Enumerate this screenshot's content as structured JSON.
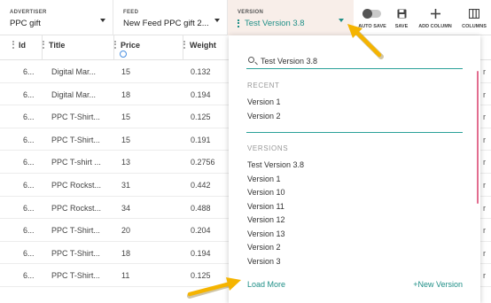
{
  "toolbar": {
    "advertiser": {
      "label": "ADVERTISER",
      "value": "PPC gift"
    },
    "feed": {
      "label": "FEED",
      "value": "New Feed PPC gift 2..."
    },
    "version": {
      "label": "VERSION",
      "value": "Test Version 3.8"
    },
    "actions": [
      {
        "label": "AUTO SAVE",
        "icon": "toggle-icon"
      },
      {
        "label": "SAVE",
        "icon": "save-icon"
      },
      {
        "label": "ADD COLUMN",
        "icon": "plus-icon"
      },
      {
        "label": "COLUMNS",
        "icon": "columns-icon"
      }
    ]
  },
  "table": {
    "headers": {
      "id": "Id",
      "title": "Title",
      "price": "Price",
      "weight": "Weight"
    },
    "rows": [
      {
        "id": "6...",
        "title": "Digital Mar...",
        "price": "15",
        "weight": "0.132",
        "extra": "r"
      },
      {
        "id": "6...",
        "title": "Digital Mar...",
        "price": "18",
        "weight": "0.194",
        "extra": "r"
      },
      {
        "id": "6...",
        "title": "PPC T-Shirt...",
        "price": "15",
        "weight": "0.125",
        "extra": "r"
      },
      {
        "id": "6...",
        "title": "PPC T-Shirt...",
        "price": "15",
        "weight": "0.191",
        "extra": "r"
      },
      {
        "id": "6...",
        "title": "PPC T-shirt ...",
        "price": "13",
        "weight": "0.2756",
        "extra": "r"
      },
      {
        "id": "6...",
        "title": "PPC Rockst...",
        "price": "31",
        "weight": "0.442",
        "extra": "r"
      },
      {
        "id": "6...",
        "title": "PPC Rockst...",
        "price": "34",
        "weight": "0.488",
        "extra": "r"
      },
      {
        "id": "6...",
        "title": "PPC T-Shirt...",
        "price": "20",
        "weight": "0.204",
        "extra": "r"
      },
      {
        "id": "6...",
        "title": "PPC T-Shirt...",
        "price": "18",
        "weight": "0.194",
        "extra": "r"
      },
      {
        "id": "6...",
        "title": "PPC T-Shirt...",
        "price": "11",
        "weight": "0.125",
        "extra": "r"
      }
    ]
  },
  "dropdown": {
    "search_value": "Test Version 3.8",
    "recent_title": "RECENT",
    "recent": [
      "Version 1",
      "Version 2"
    ],
    "versions_title": "VERSIONS",
    "versions": [
      "Test Version 3.8",
      "Version 1",
      "Version 10",
      "Version 11",
      "Version 12",
      "Version 13",
      "Version 2",
      "Version 3"
    ],
    "load_more": "Load More",
    "new_version": "+New Version"
  },
  "colors": {
    "accent": "#1f8f87",
    "version_bg": "#f8eee9",
    "annotation_arrow": "#f5b400"
  }
}
